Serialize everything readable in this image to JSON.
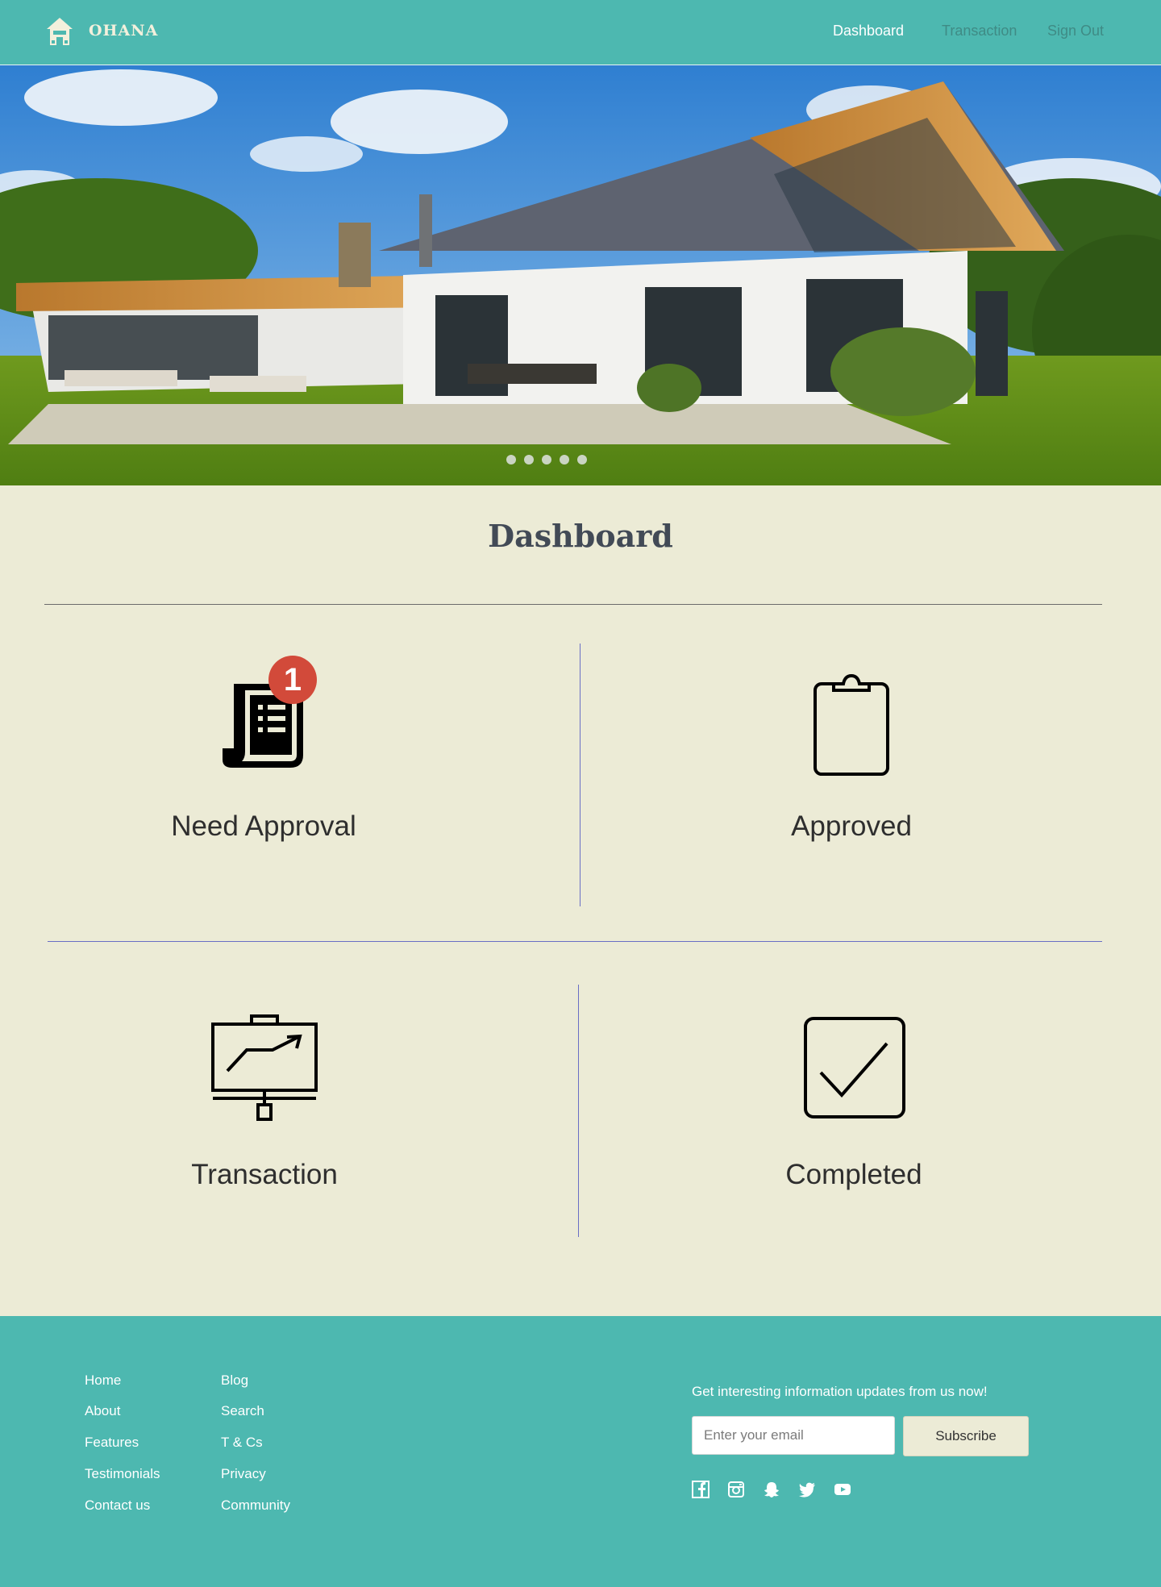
{
  "brand": {
    "name": "OHANA",
    "logo_icon": "house-icon"
  },
  "nav": {
    "links": [
      {
        "label": "Dashboard",
        "active": true
      },
      {
        "label": "Transaction",
        "active": false
      },
      {
        "label": "Sign Out",
        "active": false
      }
    ]
  },
  "hero": {
    "slide_count": 5
  },
  "page": {
    "title": "Dashboard"
  },
  "cards": [
    {
      "label": "Need Approval",
      "icon": "receipt-icon",
      "badge": "1"
    },
    {
      "label": "Approved",
      "icon": "clipboard-icon"
    },
    {
      "label": "Transaction",
      "icon": "presentation-board-icon"
    },
    {
      "label": "Completed",
      "icon": "checkbox-checked-icon"
    }
  ],
  "footer": {
    "col1": [
      "Home",
      "About",
      "Features",
      "Testimonials",
      "Contact us"
    ],
    "col2": [
      "Blog",
      "Search",
      "T & Cs",
      "Privacy",
      "Community"
    ],
    "newsletter_text": "Get interesting information updates from us now!",
    "email_placeholder": "Enter your email",
    "subscribe_label": "Subscribe",
    "social": [
      "facebook-icon",
      "instagram-icon",
      "snapchat-icon",
      "twitter-icon",
      "youtube-icon"
    ]
  },
  "colors": {
    "teal": "#4db8b0",
    "cream": "#ecebd6",
    "badge_red": "#d24a3a",
    "divider_blue": "#6a6fc5"
  }
}
